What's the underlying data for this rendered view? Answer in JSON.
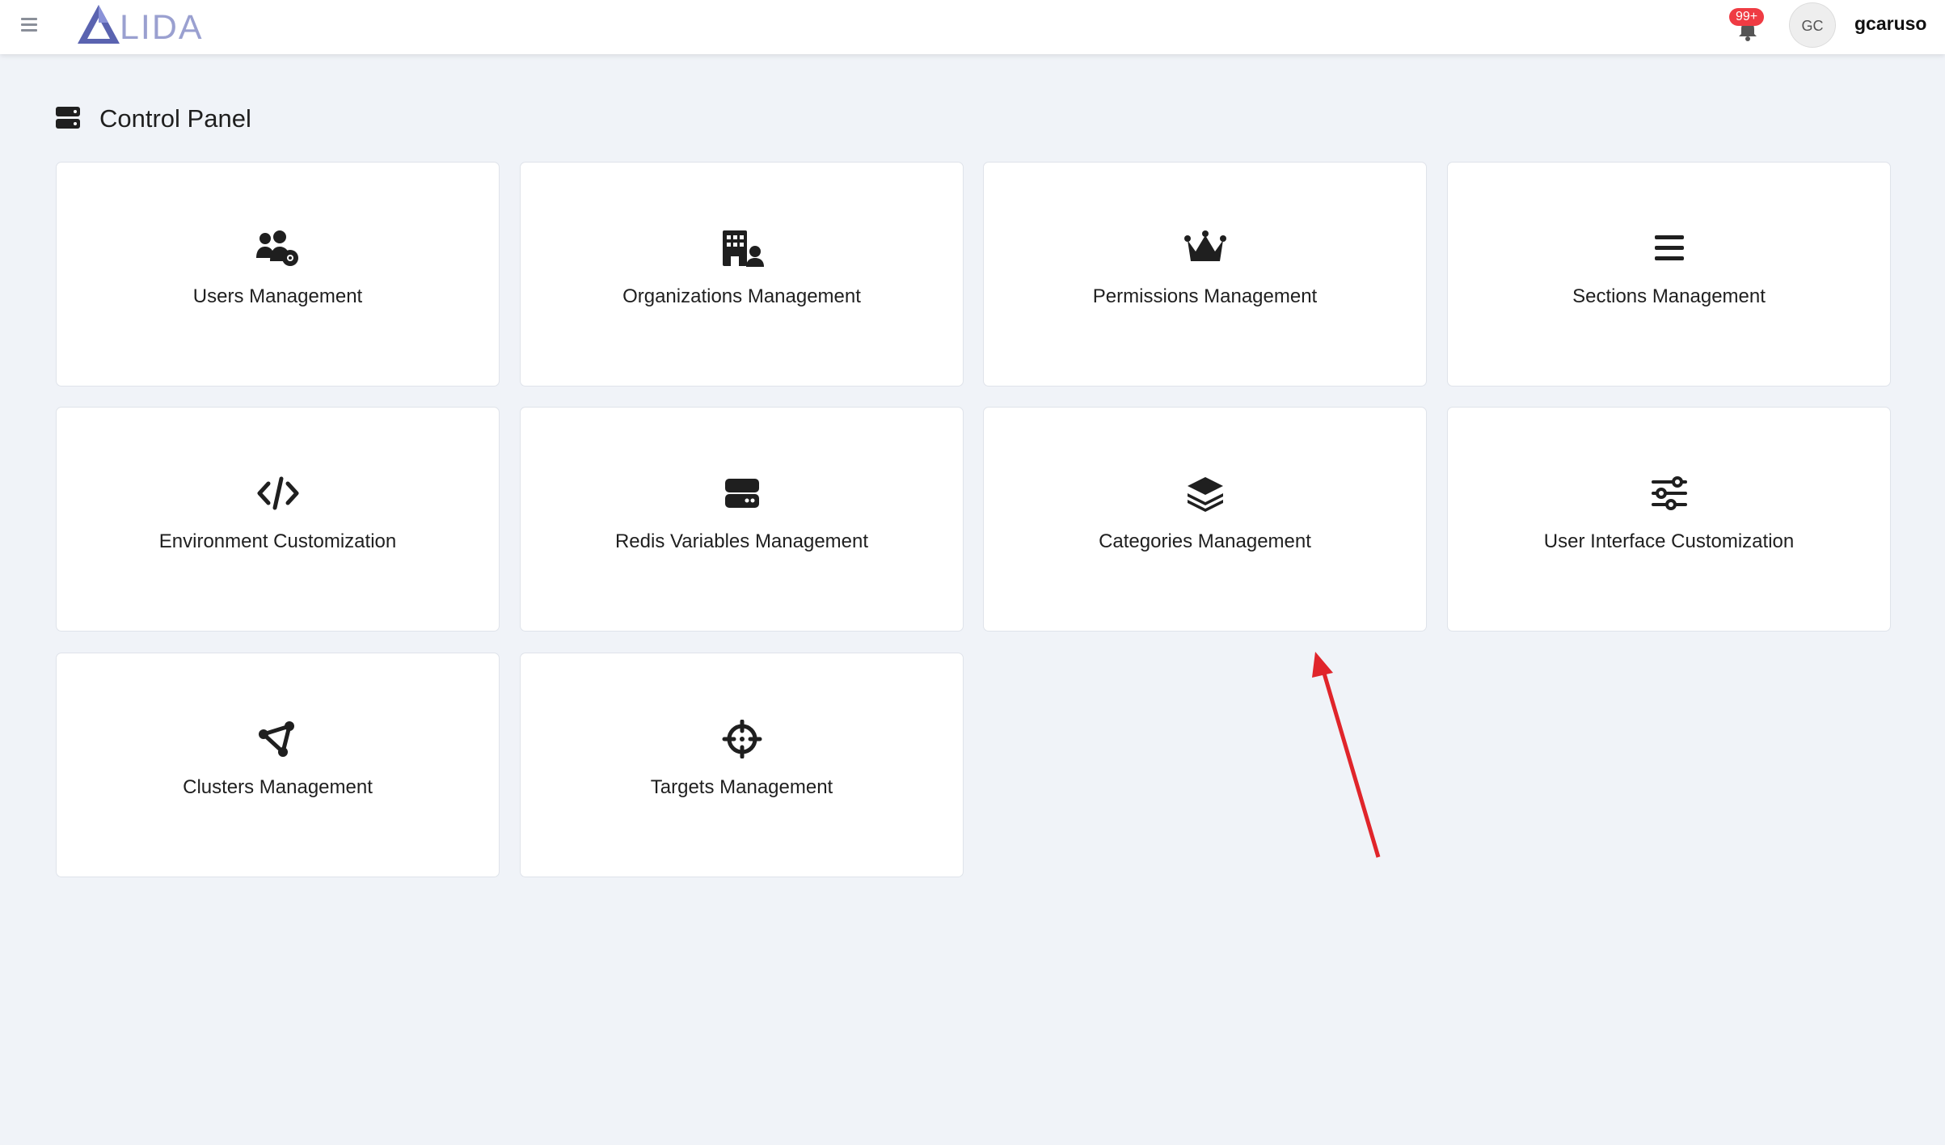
{
  "header": {
    "logo_text": "LIDA",
    "notifications_badge": "99+",
    "avatar_initials": "GC",
    "username": "gcaruso"
  },
  "page": {
    "title": "Control Panel"
  },
  "cards": [
    {
      "label": "Users Management",
      "icon": "users-gear-icon"
    },
    {
      "label": "Organizations Management",
      "icon": "building-user-icon"
    },
    {
      "label": "Permissions Management",
      "icon": "crown-icon"
    },
    {
      "label": "Sections Management",
      "icon": "bars-icon"
    },
    {
      "label": "Environment Customization",
      "icon": "code-icon"
    },
    {
      "label": "Redis Variables Management",
      "icon": "server-icon"
    },
    {
      "label": "Categories Management",
      "icon": "layer-group-icon"
    },
    {
      "label": "User Interface Customization",
      "icon": "sliders-icon"
    },
    {
      "label": "Clusters Management",
      "icon": "cluster-nodes-icon"
    },
    {
      "label": "Targets Management",
      "icon": "crosshairs-icon"
    }
  ],
  "colors": {
    "background": "#f0f3f8",
    "card_border": "#dfe3ea",
    "badge": "#ef3b43",
    "logo": "#5a63b0",
    "annotation_arrow": "#e0252b"
  }
}
